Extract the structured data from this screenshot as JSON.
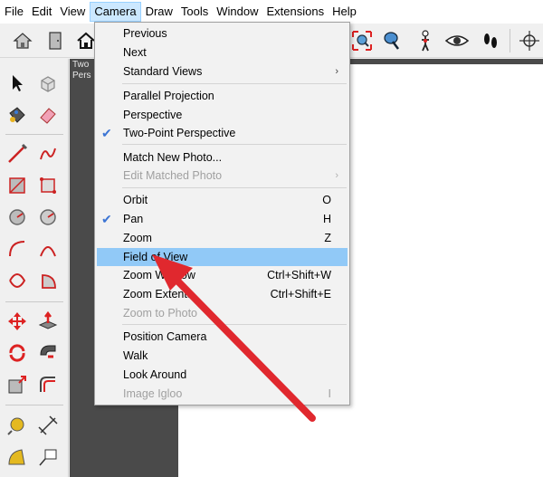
{
  "menubar": {
    "items": [
      "File",
      "Edit",
      "View",
      "Camera",
      "Draw",
      "Tools",
      "Window",
      "Extensions",
      "Help"
    ],
    "active_index": 3
  },
  "scene_tab": {
    "line1": "Two",
    "line2": "Pers"
  },
  "camera_menu": {
    "items": [
      {
        "label": "Previous",
        "shortcut": "",
        "checked": false,
        "disabled": false,
        "submenu": false
      },
      {
        "label": "Next",
        "shortcut": "",
        "checked": false,
        "disabled": false,
        "submenu": false
      },
      {
        "label": "Standard Views",
        "shortcut": "",
        "checked": false,
        "disabled": false,
        "submenu": true
      },
      {
        "label": "Parallel Projection",
        "shortcut": "",
        "checked": false,
        "disabled": false,
        "submenu": false
      },
      {
        "label": "Perspective",
        "shortcut": "",
        "checked": false,
        "disabled": false,
        "submenu": false
      },
      {
        "label": "Two-Point Perspective",
        "shortcut": "",
        "checked": true,
        "disabled": false,
        "submenu": false
      },
      {
        "label": "Match New Photo...",
        "shortcut": "",
        "checked": false,
        "disabled": false,
        "submenu": false
      },
      {
        "label": "Edit Matched Photo",
        "shortcut": "",
        "checked": false,
        "disabled": true,
        "submenu": true
      },
      {
        "label": "Orbit",
        "shortcut": "O",
        "checked": false,
        "disabled": false,
        "submenu": false
      },
      {
        "label": "Pan",
        "shortcut": "H",
        "checked": true,
        "disabled": false,
        "submenu": false
      },
      {
        "label": "Zoom",
        "shortcut": "Z",
        "checked": false,
        "disabled": false,
        "submenu": false
      },
      {
        "label": "Field of View",
        "shortcut": "",
        "checked": false,
        "disabled": false,
        "submenu": false,
        "highlighted": true
      },
      {
        "label": "Zoom Window",
        "shortcut": "Ctrl+Shift+W",
        "checked": false,
        "disabled": false,
        "submenu": false
      },
      {
        "label": "Zoom Extents",
        "shortcut": "Ctrl+Shift+E",
        "checked": false,
        "disabled": false,
        "submenu": false
      },
      {
        "label": "Zoom to Photo",
        "shortcut": "",
        "checked": false,
        "disabled": true,
        "submenu": false
      },
      {
        "label": "Position Camera",
        "shortcut": "",
        "checked": false,
        "disabled": false,
        "submenu": false
      },
      {
        "label": "Walk",
        "shortcut": "",
        "checked": false,
        "disabled": false,
        "submenu": false
      },
      {
        "label": "Look Around",
        "shortcut": "",
        "checked": false,
        "disabled": false,
        "submenu": false
      },
      {
        "label": "Image Igloo",
        "shortcut": "I",
        "checked": false,
        "disabled": true,
        "submenu": false
      }
    ]
  },
  "icons": {
    "submenu_arrow": "›",
    "check_mark": "✔",
    "toolbar": [
      "house-icon",
      "door-icon",
      "home-icon",
      "zoom-extents-icon",
      "position-camera-icon",
      "walk-person-icon",
      "look-around-eye-icon",
      "footprints-icon",
      "section-plane-icon"
    ],
    "palette": [
      "select-arrow-icon",
      "component-icon",
      "paint-bucket-icon",
      "eraser-icon",
      "pencil-line-icon",
      "freehand-icon",
      "rectangle-icon",
      "rotated-rectangle-icon",
      "circle-icon",
      "polygon-icon",
      "arc-icon",
      "two-point-arc-icon",
      "three-point-arc-icon",
      "pie-icon",
      "move-icon",
      "push-pull-icon",
      "rotate-icon",
      "follow-me-icon",
      "scale-icon",
      "offset-icon",
      "tape-measure-icon",
      "dimension-icon",
      "protractor-icon",
      "text-label-icon"
    ]
  },
  "colors": {
    "accent_red": "#e0282e",
    "highlight": "#91c9f7",
    "check_blue": "#3b74d4",
    "frame_dark": "#4a4a4a"
  }
}
